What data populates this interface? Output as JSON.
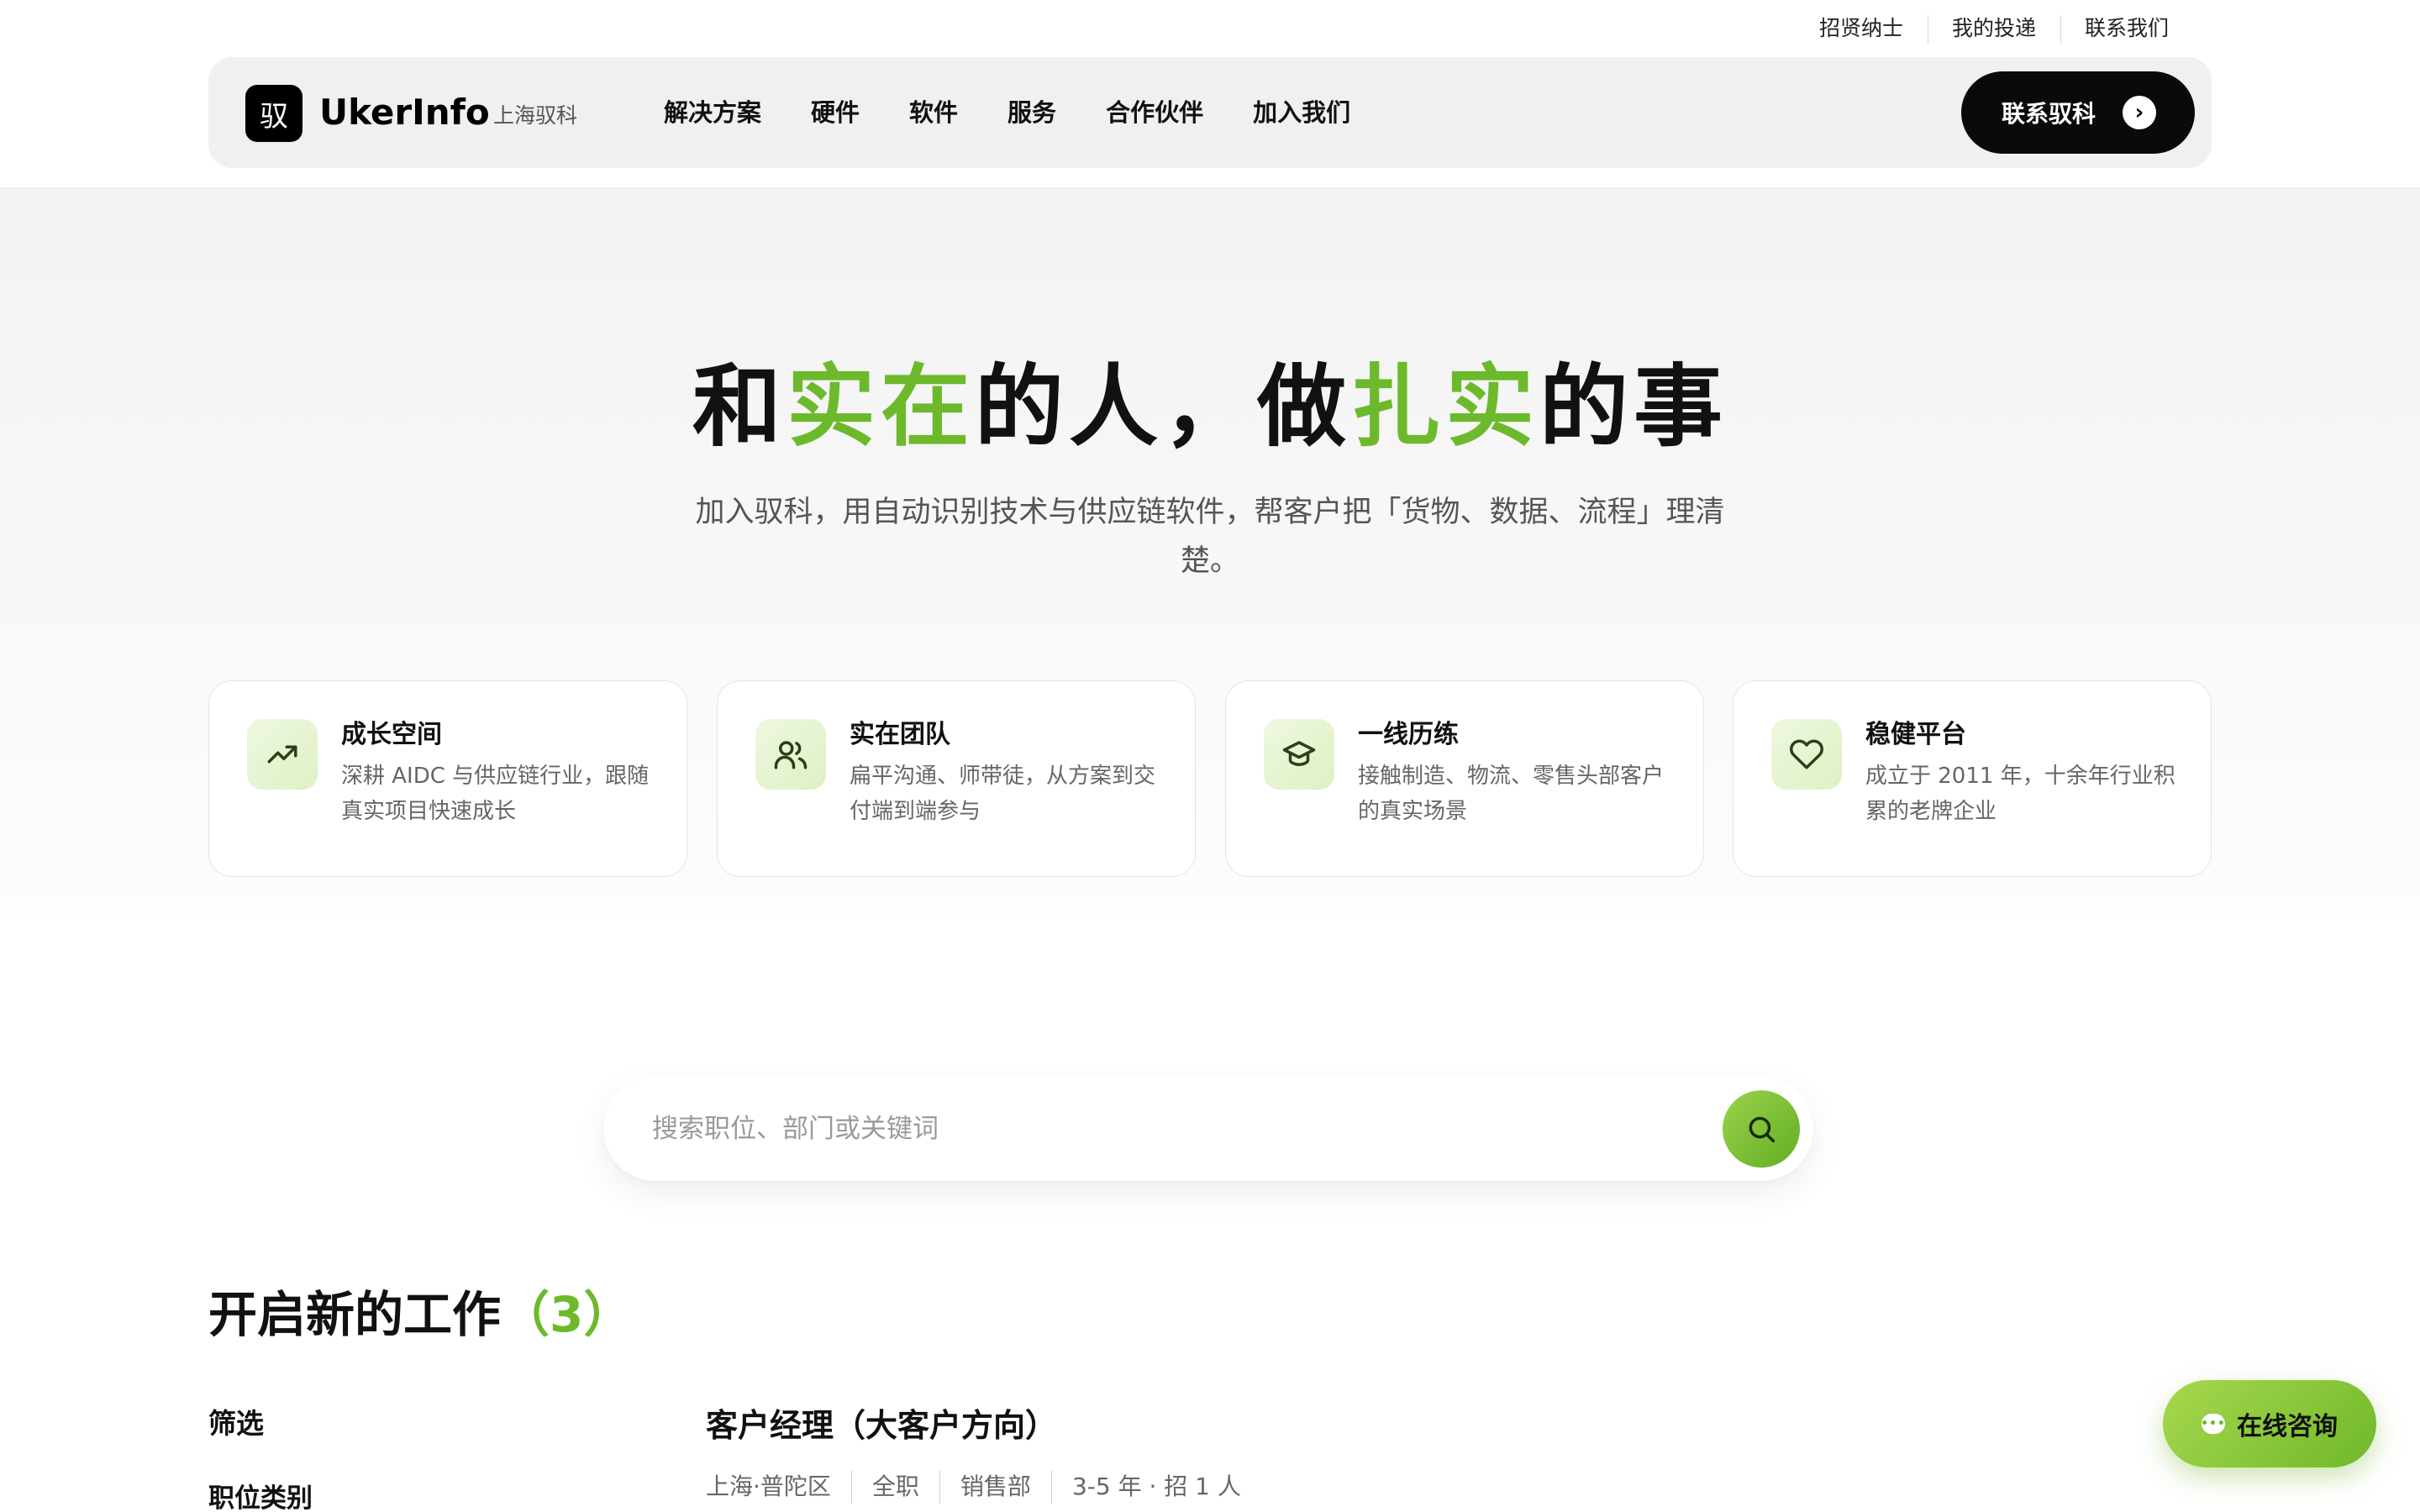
{
  "top_links": [
    "招贤纳士",
    "我的投递",
    "联系我们"
  ],
  "header": {
    "logo_glyph": "驭",
    "brand": "UkerInfo",
    "brand_sub": "上海驭科",
    "nav": [
      "解决方案",
      "硬件",
      "软件",
      "服务",
      "合作伙伴",
      "加入我们"
    ],
    "cta_label": "联系驭科",
    "cta_icon": "chevron-right-icon"
  },
  "hero": {
    "title_parts": [
      "和",
      "实在",
      "的人，做",
      "扎实",
      "的事"
    ],
    "subtitle": "加入驭科，用自动识别技术与供应链软件，帮客户把「货物、数据、流程」理清楚。",
    "accent_color": "#6cba2c"
  },
  "cards": [
    {
      "icon": "trending-up-icon",
      "title": "成长空间",
      "desc": "深耕 AIDC 与供应链行业，跟随真实项目快速成长"
    },
    {
      "icon": "users-icon",
      "title": "实在团队",
      "desc": "扁平沟通、师带徒，从方案到交付端到端参与"
    },
    {
      "icon": "graduation-cap-icon",
      "title": "一线历练",
      "desc": "接触制造、物流、零售头部客户的真实场景"
    },
    {
      "icon": "heart-icon",
      "title": "稳健平台",
      "desc": "成立于 2011 年，十余年行业积累的老牌企业"
    }
  ],
  "search": {
    "placeholder": "搜索职位、部门或关键词",
    "value": "",
    "button_icon": "search-icon"
  },
  "jobs": {
    "heading": "开启新的工作",
    "count": "（3）",
    "filter_label": "筛选",
    "filter_category": "职位类别",
    "first_job": {
      "title": "客户经理（大客户方向）",
      "meta": [
        "上海·普陀区",
        "全职",
        "销售部",
        "3-5 年 · 招 1 人"
      ]
    }
  },
  "consult": {
    "label": "在线咨询",
    "icon": "chat-icon"
  }
}
